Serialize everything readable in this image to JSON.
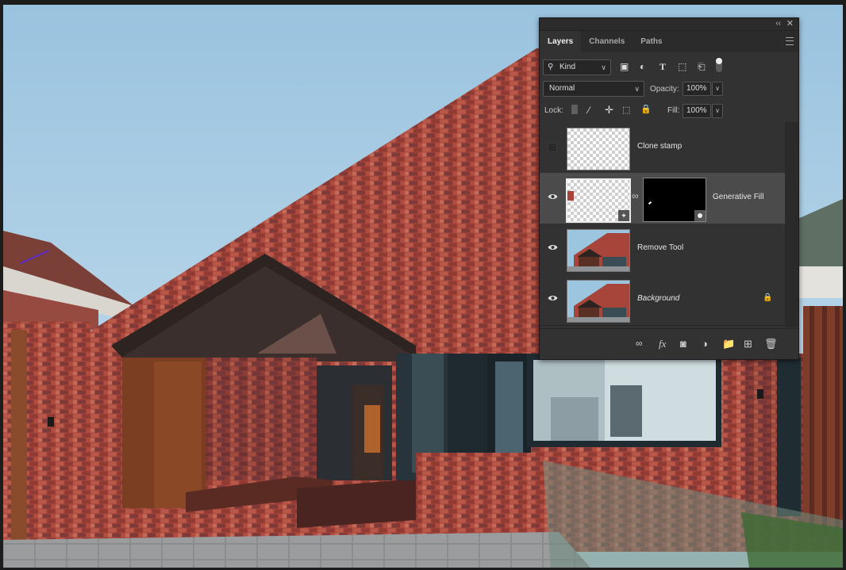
{
  "panel": {
    "tabs": [
      {
        "label": "Layers",
        "active": true
      },
      {
        "label": "Channels",
        "active": false
      },
      {
        "label": "Paths",
        "active": false
      }
    ],
    "filter_kind": "Kind",
    "blend_mode": "Normal",
    "opacity_label": "Opacity:",
    "opacity_value": "100%",
    "lock_label": "Lock:",
    "fill_label": "Fill:",
    "fill_value": "100%",
    "layers": [
      {
        "name": "Clone stamp",
        "visible": false,
        "thumb": "transparent",
        "selected": false
      },
      {
        "name": "Generative Fill",
        "visible": true,
        "thumb": "transparent-with-mask",
        "selected": true
      },
      {
        "name": "Remove Tool",
        "visible": true,
        "thumb": "photo",
        "selected": false
      },
      {
        "name": "Background",
        "visible": true,
        "thumb": "photo",
        "selected": false,
        "locked": true
      }
    ]
  },
  "colors": {
    "panel_bg": "#323232",
    "selected_row": "#4b4b4b",
    "sky": "#a9cce3",
    "brick": "#b04a3c"
  },
  "icons": {
    "filter": "search-icon",
    "image_filter": "image-icon",
    "adjustment_filter": "adjustment-icon",
    "type_filter": "type-icon",
    "shape_filter": "shape-icon",
    "smart_object_filter": "smart-object-icon",
    "lock_transparent": "checkerboard-icon",
    "lock_pixels": "brush-icon",
    "lock_position": "move-icon",
    "lock_artboard": "artboard-icon",
    "lock_all": "lock-icon",
    "link_layers": "link-icon",
    "fx": "fx-icon",
    "add_mask": "mask-icon",
    "new_fill_adjustment": "half-circle-icon",
    "new_group": "folder-icon",
    "new_layer": "new-layer-icon",
    "delete": "trash-icon"
  }
}
